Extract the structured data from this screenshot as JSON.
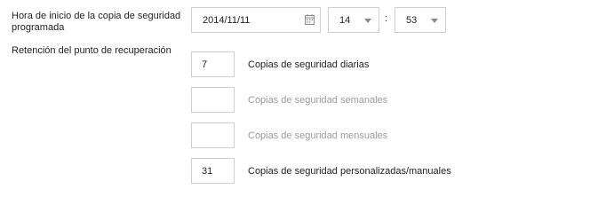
{
  "schedule": {
    "label": "Hora de inicio de la copia de seguridad programada",
    "date_value": "2014/11/11",
    "hour_value": "14",
    "separator": ":",
    "minute_value": "53"
  },
  "retention": {
    "label": "Retención del punto de recuperación",
    "rows": [
      {
        "value": "7",
        "label": "Copias de seguridad diarias"
      },
      {
        "value": "",
        "label": "Copias de seguridad semanales"
      },
      {
        "value": "",
        "label": "Copias de seguridad mensuales"
      },
      {
        "value": "31",
        "label": "Copias de seguridad personalizadas/manuales"
      }
    ]
  }
}
